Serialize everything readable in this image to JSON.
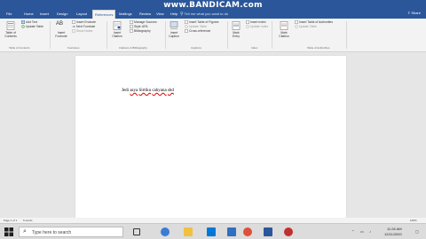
{
  "watermark": {
    "brand": "www.BANDICAM.com",
    "sub": ""
  },
  "tabs": [
    {
      "label": "File"
    },
    {
      "label": "Home"
    },
    {
      "label": "Insert"
    },
    {
      "label": "Design"
    },
    {
      "label": "Layout"
    },
    {
      "label": "References"
    },
    {
      "label": "Mailings"
    },
    {
      "label": "Review"
    },
    {
      "label": "View"
    },
    {
      "label": "Help"
    }
  ],
  "tell_me": "Tell me what you want to do",
  "share": "Share",
  "ribbon": {
    "toc": {
      "big_label": "Table of\nContents",
      "add_text": "Add Text",
      "update_table": "Update Table",
      "group": "Table of Contents"
    },
    "footnotes": {
      "insert_footnote_big": "Insert\nFootnote",
      "ab_glyph": "AB",
      "insert_endnote": "Insert Endnote",
      "next_footnote": "Next Footnote",
      "show_notes": "Show Notes",
      "group": "Footnotes"
    },
    "citations": {
      "insert_citation_big": "Insert\nCitation",
      "manage_sources": "Manage Sources",
      "style_label": "Style:",
      "style_value": "APA",
      "bibliography": "Bibliography",
      "group": "Citations & Bibliography"
    },
    "captions": {
      "insert_caption_big": "Insert\nCaption",
      "insert_table_of_figures": "Insert Table of Figures",
      "update_table": "Update Table",
      "cross_reference": "Cross-reference",
      "group": "Captions"
    },
    "index": {
      "mark_entry_big": "Mark\nEntry",
      "insert_index": "Insert Index",
      "update_index": "Update Index",
      "group": "Index"
    },
    "authorities": {
      "mark_citation_big": "Mark\nCitation",
      "insert_table_of_authorities": "Insert Table of Authorities",
      "update_table": "Update Table",
      "group": "Table of Authorities"
    }
  },
  "document": {
    "word1": "Jedi",
    "word2": "asya",
    "word3": "Sirtiku",
    "word4": "cahyana",
    "word5": "shd"
  },
  "status": {
    "page": "Page 1 of 1",
    "words": "5 words",
    "zoom": "100%"
  },
  "taskbar": {
    "search_placeholder": "Type here to search",
    "time": "11:26 AM",
    "date": "12/11/2020"
  }
}
